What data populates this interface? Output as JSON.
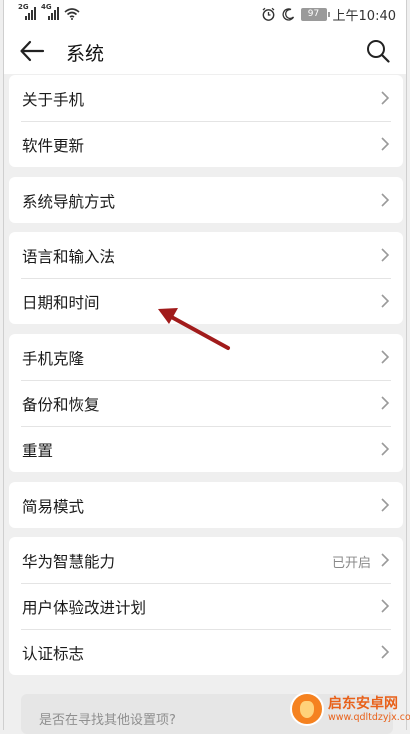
{
  "status_bar": {
    "signal1": "2G",
    "signal2": "4G",
    "battery": "97",
    "time": "上午10:40"
  },
  "header": {
    "title": "系统"
  },
  "groups": [
    {
      "items": [
        {
          "label": "关于手机"
        },
        {
          "label": "软件更新"
        }
      ]
    },
    {
      "items": [
        {
          "label": "系统导航方式"
        }
      ]
    },
    {
      "items": [
        {
          "label": "语言和输入法"
        },
        {
          "label": "日期和时间"
        }
      ]
    },
    {
      "items": [
        {
          "label": "手机克隆"
        },
        {
          "label": "备份和恢复"
        },
        {
          "label": "重置"
        }
      ]
    },
    {
      "items": [
        {
          "label": "简易模式"
        }
      ]
    },
    {
      "items": [
        {
          "label": "华为智慧能力",
          "value": "已开启"
        },
        {
          "label": "用户体验改进计划"
        },
        {
          "label": "认证标志"
        }
      ]
    }
  ],
  "suggestion": {
    "text": "是否在寻找其他设置项?"
  },
  "annotation": {
    "color": "#a11b1b"
  },
  "watermark": {
    "name": "启东安卓网",
    "url": "www.qdltdzyjx.com"
  }
}
